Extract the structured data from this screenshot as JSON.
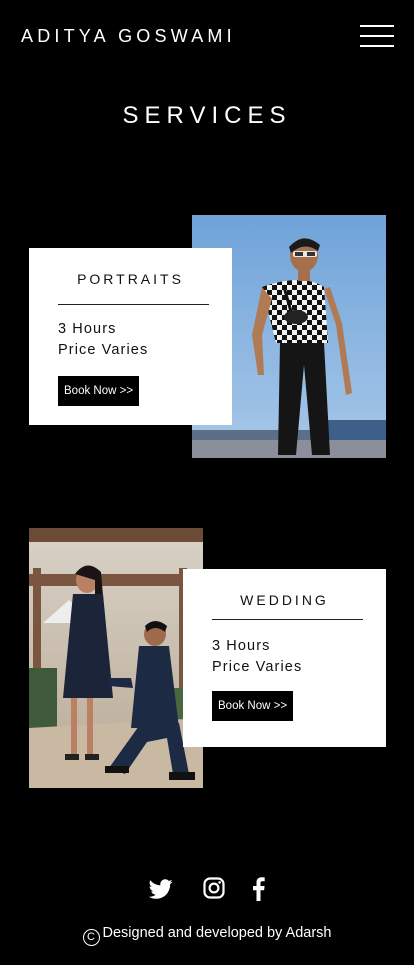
{
  "header": {
    "brand": "ADITYA GOSWAMI",
    "menu_icon": "hamburger-menu-icon"
  },
  "services_title": "SERVICES",
  "services": [
    {
      "title": "PORTRAITS",
      "duration": "3 Hours",
      "price": "Price Varies",
      "button": "Book Now >>",
      "photo": "man-in-checkered-shirt-photo"
    },
    {
      "title": "WEDDING",
      "duration": "3 Hours",
      "price": "Price Varies",
      "button": "Book Now >>",
      "photo": "marriage-proposal-photo"
    }
  ],
  "social": {
    "icons": [
      "twitter-icon",
      "instagram-icon",
      "facebook-icon"
    ]
  },
  "footer": {
    "text": "Designed and developed by Adarsh",
    "copyright_symbol": "C"
  },
  "colors": {
    "background": "#000000",
    "card": "#ffffff",
    "button": "#000000"
  }
}
